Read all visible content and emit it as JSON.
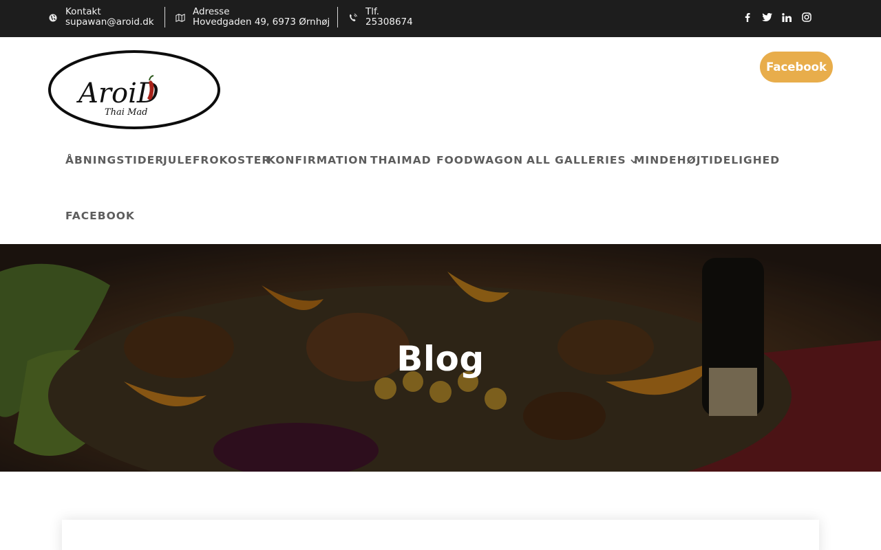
{
  "topbar": {
    "contact": {
      "icon": "globe-icon",
      "label": "Kontakt",
      "value": "supawan@aroid.dk"
    },
    "address": {
      "icon": "map-icon",
      "label": "Adresse",
      "value": "Hovedgaden 49, 6973 Ørnhøj"
    },
    "phone": {
      "icon": "phone-icon",
      "label": "Tlf.",
      "value": "25308674"
    },
    "social": [
      "facebook-icon",
      "twitter-icon",
      "linkedin-icon",
      "instagram-icon"
    ]
  },
  "header": {
    "logo_text": "AroiD",
    "logo_subtext": "Thai Mad",
    "facebook_button": "Facebook",
    "accent_color": "#e8ad4b"
  },
  "nav": {
    "items": [
      "ÅBNINGSTIDER",
      "JULEFROKOSTER",
      "KONFIRMATION",
      "THAIMAD",
      "FOODWAGON",
      "ALL GALLERIES",
      "MINDEHØJTIDELIGHED",
      "FACEBOOK"
    ]
  },
  "hero": {
    "title": "Blog"
  }
}
